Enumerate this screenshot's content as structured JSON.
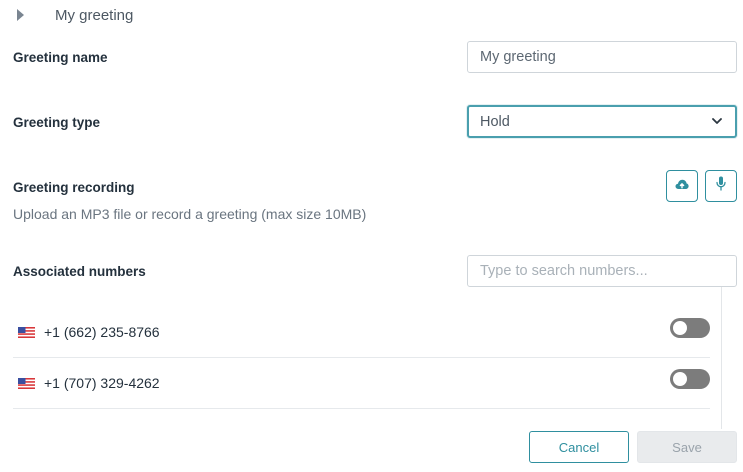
{
  "header": {
    "title": "My greeting",
    "expanded": false
  },
  "form": {
    "name": {
      "label": "Greeting name",
      "value": "My greeting"
    },
    "type": {
      "label": "Greeting type",
      "selected": "Hold"
    },
    "recording": {
      "label": "Greeting recording",
      "hint": "Upload an MP3 file or record a greeting (max size 10MB)",
      "upload_icon": "cloud-upload-icon",
      "record_icon": "microphone-icon"
    },
    "numbers": {
      "label": "Associated numbers",
      "search_placeholder": "Type to search numbers...",
      "items": [
        {
          "flag": "us-flag-icon",
          "number": "+1 (662) 235-8766",
          "enabled": false
        },
        {
          "flag": "us-flag-icon",
          "number": "+1 (707) 329-4262",
          "enabled": false
        }
      ]
    }
  },
  "actions": {
    "cancel_label": "Cancel",
    "save_label": "Save",
    "save_disabled": true
  },
  "colors": {
    "accent": "#2f8f9f",
    "focus": "#4a9fae",
    "toggle_off": "#7c7c7c"
  }
}
